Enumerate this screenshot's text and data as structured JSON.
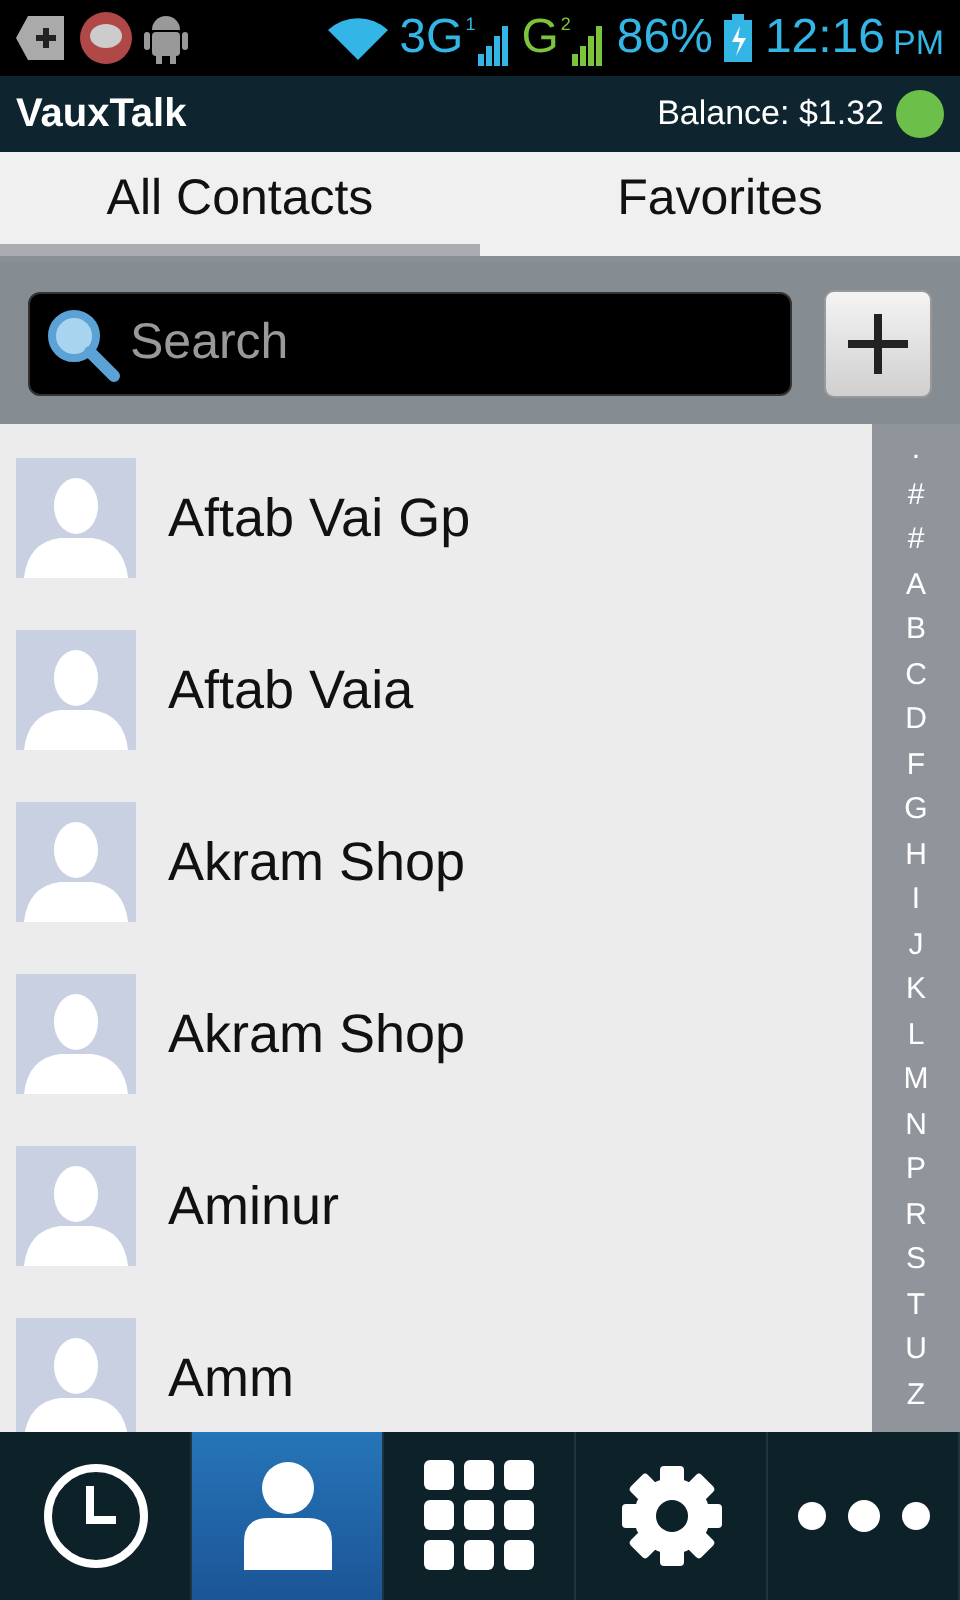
{
  "status_bar": {
    "network_1": "3G",
    "sim_1": "1",
    "network_2": "G",
    "sim_2": "2",
    "battery": "86%",
    "time": "12:16",
    "am_pm": "PM"
  },
  "app_bar": {
    "title": "VauxTalk",
    "balance": "Balance: $1.32"
  },
  "tabs": [
    {
      "label": "All Contacts",
      "selected": true
    },
    {
      "label": "Favorites",
      "selected": false
    }
  ],
  "search": {
    "placeholder": "Search"
  },
  "contacts": [
    {
      "name": "Aftab Vai Gp"
    },
    {
      "name": "Aftab Vaia"
    },
    {
      "name": "Akram Shop"
    },
    {
      "name": "Akram Shop"
    },
    {
      "name": "Aminur"
    },
    {
      "name": "Amm"
    }
  ],
  "index": [
    ".",
    "#",
    "#",
    "A",
    "B",
    "C",
    "D",
    "F",
    "G",
    "H",
    "I",
    "J",
    "K",
    "L",
    "M",
    "N",
    "P",
    "R",
    "S",
    "T",
    "U",
    "Z"
  ],
  "nav": [
    {
      "kind": "history",
      "selected": false
    },
    {
      "kind": "contacts",
      "selected": true
    },
    {
      "kind": "dialpad",
      "selected": false
    },
    {
      "kind": "settings",
      "selected": false
    },
    {
      "kind": "more",
      "selected": false
    }
  ]
}
